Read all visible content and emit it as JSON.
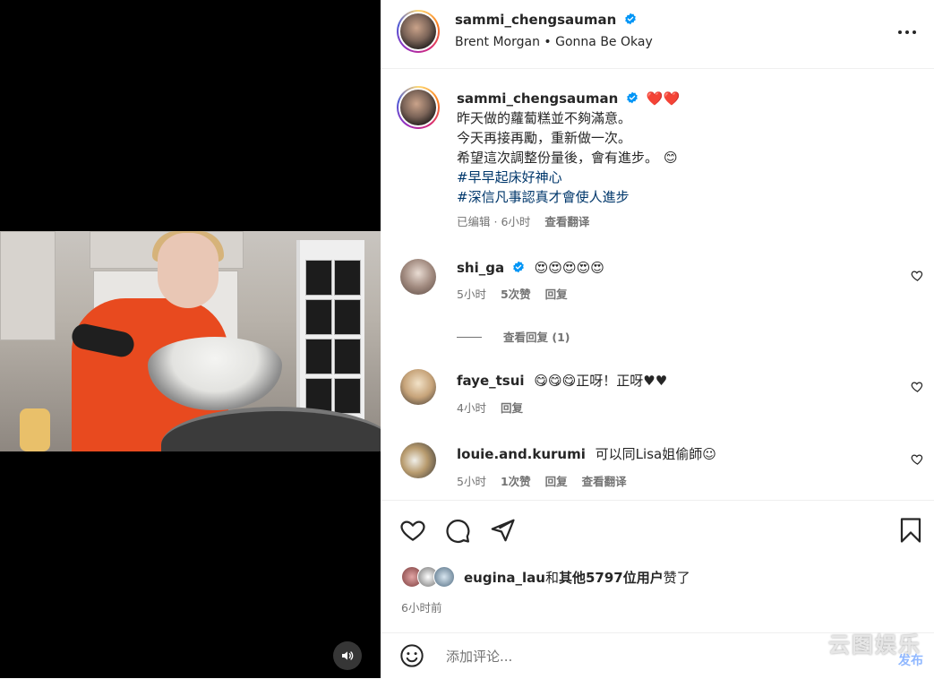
{
  "post": {
    "username": "sammi_chengsauman",
    "audio": "Brent Morgan • Gonna Be Okay",
    "caption": {
      "hearts": "❤️❤️",
      "lines": [
        "昨天做的蘿蔔糕並不夠滿意。",
        "今天再接再勵，重新做一次。",
        "希望這次調整份量後，會有進步。"
      ],
      "smile": "😊",
      "hashtags": [
        "#早早起床好神心",
        "#深信凡事認真才會使人進步"
      ],
      "edited": "已编辑",
      "time": "6小时",
      "translate": "查看翻译"
    }
  },
  "comments": [
    {
      "username": "shi_ga",
      "verified": true,
      "text": "😍😍😍😍😍",
      "time": "5小时",
      "likes": "5次赞",
      "reply": "回复",
      "view_replies": "查看回复 (1)"
    },
    {
      "username": "faye_tsui",
      "text": "😋😋😋正呀！正呀♥♥",
      "time": "4小时",
      "reply": "回复"
    },
    {
      "username": "louie.and.kurumi",
      "text": "可以同Lisa姐偷師☺",
      "time": "5小时",
      "likes": "1次赞",
      "reply": "回复",
      "translate": "查看翻译"
    }
  ],
  "likes_line": {
    "user": "eugina_lau",
    "joiner": "和",
    "others": "其他5797位用户",
    "suffix": "赞了"
  },
  "posted_ago": "6小时前",
  "add_comment_placeholder": "添加评论...",
  "watermark": {
    "main": "云图娱乐",
    "sub": "发布"
  },
  "colors": {
    "verified": "#0095f6",
    "hashtag": "#00376b",
    "muted": "#737373",
    "text": "#262626"
  },
  "icons": [
    "volume-icon",
    "more-icon",
    "verified-icon",
    "heart-icon",
    "comment-icon",
    "share-icon",
    "bookmark-icon",
    "emoji-icon"
  ]
}
